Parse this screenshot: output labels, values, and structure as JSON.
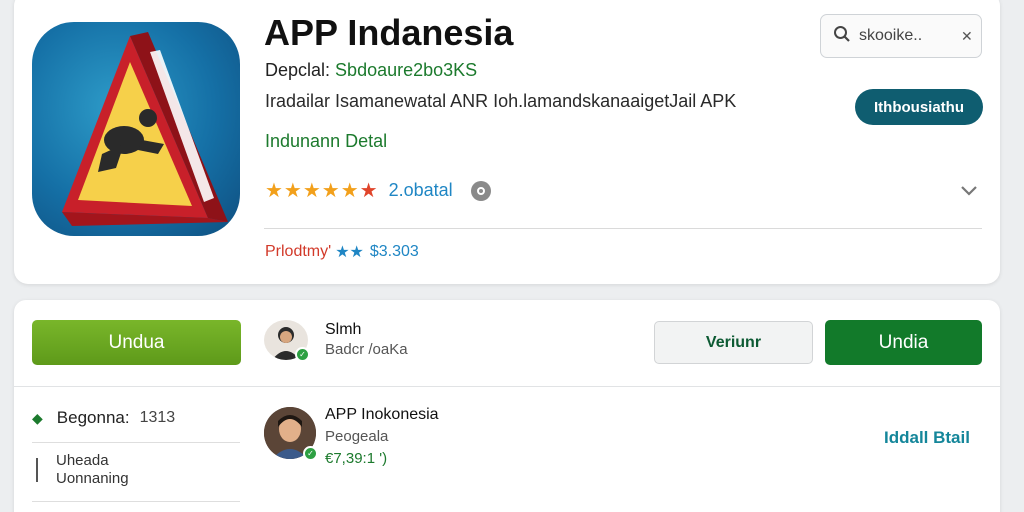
{
  "app": {
    "title": "APP Indanesia",
    "developer_label": "Depclal:",
    "developer_value": "Sbdoaure2bo3KS",
    "description": "Iradailar Isamanewatal ANR Ioh.lamandskanaaigetJail APK",
    "category": "Indunann Detal",
    "stars": "★★★★★",
    "last_star": "★",
    "rating_value": "2.obatal",
    "price_label": "Prlodtmy'",
    "price_stars": "★★",
    "price_value": "$3.303",
    "primary_button": "Ithbousiathu"
  },
  "search": {
    "text": "skooike..",
    "clear_symbol": "✕"
  },
  "actions": {
    "download_left": "Undua",
    "version_button": "Veriunr",
    "download_right": "Undia"
  },
  "author_top": {
    "name": "Slmh",
    "sub": "Badcr /oaKa"
  },
  "sidebar": {
    "item1_label": "Begonna:",
    "item1_count": "1313",
    "item2_line1": "Uheada",
    "item2_line2": "Uonnaning"
  },
  "review_entry": {
    "title": "APP Inokonesia",
    "subtitle": "Peogeala",
    "price": "€7,39:1 ')",
    "detail_link": "Iddall Btail"
  },
  "colors": {
    "accent_green": "#127a2a",
    "light_green": "#6aa821",
    "teal": "#0f5d70",
    "link_blue": "#1f86c4",
    "star_gold": "#f2a01b"
  },
  "icons": {
    "search": "magnifier",
    "clear": "close-x",
    "chevron": "chevron-down",
    "info": "info-circle",
    "verified": "check-badge",
    "sidebar_marker": "diamond"
  }
}
